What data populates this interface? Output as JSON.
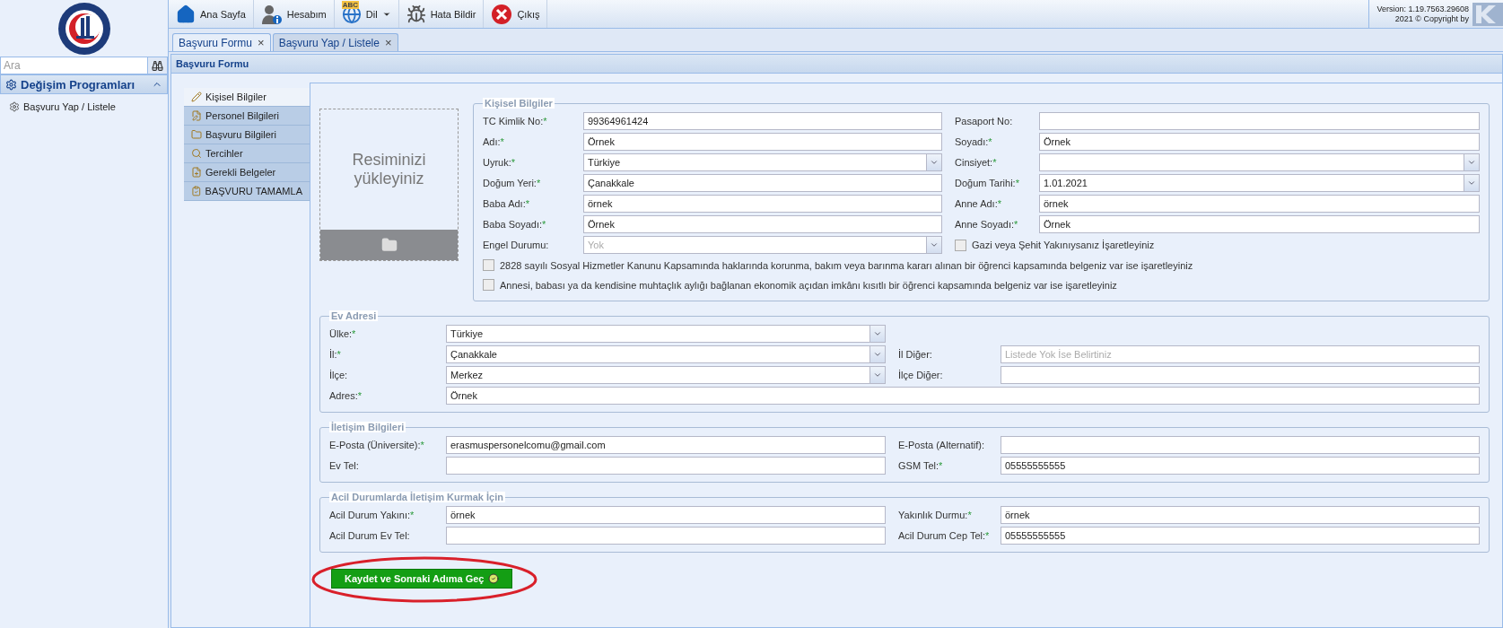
{
  "sidebar": {
    "search": {
      "placeholder": "Ara"
    },
    "section": {
      "title": "Değişim Programları",
      "expanded": true
    },
    "items": [
      {
        "label": "Başvuru Yap / Listele",
        "selected": false
      }
    ]
  },
  "toolbar": {
    "items": [
      {
        "label": "Ana Sayfa",
        "kind": "home"
      },
      {
        "label": "Hesabım",
        "kind": "account"
      },
      {
        "label": "Dil",
        "kind": "language",
        "badge": "ABC",
        "dropdown": true
      },
      {
        "label": "Hata Bildir",
        "kind": "bug"
      },
      {
        "label": "Çıkış",
        "kind": "exit"
      }
    ],
    "version": "Version: 1.19.7563.29608",
    "copyright": "2021 © Copyright by"
  },
  "tabs": [
    {
      "label": "Başvuru Formu",
      "selected": true,
      "close": "×"
    },
    {
      "label": "Başvuru Yap / Listele",
      "selected": false,
      "close": "×"
    }
  ],
  "panel": {
    "title": "Başvuru Formu"
  },
  "steps": [
    {
      "label": "Kişisel Bilgiler",
      "selected": true
    },
    {
      "label": "Personel Bilgileri",
      "selected": false
    },
    {
      "label": "Başvuru Bilgileri",
      "selected": false
    },
    {
      "label": "Tercihler",
      "selected": false
    },
    {
      "label": "Gerekli Belgeler",
      "selected": false
    },
    {
      "label": "BAŞVURU TAMAMLA",
      "selected": false
    }
  ],
  "photo_upload": {
    "text": "Resiminizi yükleyiniz"
  },
  "sections": [
    {
      "title": "Kişisel Bilgiler",
      "rows": [
        {
          "left": {
            "kind": "text",
            "label": "TC Kimlik No:",
            "asterisk": "*",
            "value": "99364961424"
          },
          "right": {
            "kind": "text",
            "label": "Pasaport No:"
          }
        },
        {
          "left": {
            "kind": "text",
            "label": "Adı:",
            "asterisk": "*",
            "value": "Örnek"
          },
          "right": {
            "kind": "text",
            "label": "Soyadı:",
            "asterisk": "*",
            "value": "Örnek"
          }
        },
        {
          "left": {
            "kind": "select",
            "label": "Uyruk:",
            "asterisk": "*",
            "value": "Türkiye"
          },
          "right": {
            "kind": "select",
            "label": "Cinsiyet:",
            "asterisk": "*"
          }
        },
        {
          "left": {
            "kind": "text",
            "label": "Doğum Yeri:",
            "asterisk": "*",
            "value": "Çanakkale"
          },
          "right": {
            "kind": "select",
            "label": "Doğum Tarihi:",
            "asterisk": "*",
            "value": "1.01.2021"
          }
        },
        {
          "left": {
            "kind": "text",
            "label": "Baba Adı:",
            "asterisk": "*",
            "value": "örnek"
          },
          "right": {
            "kind": "text",
            "label": "Anne Adı:",
            "asterisk": "*",
            "value": "örnek"
          }
        },
        {
          "left": {
            "kind": "text",
            "label": "Baba Soyadı:",
            "asterisk": "*",
            "value": "Örnek"
          },
          "right": {
            "kind": "text",
            "label": "Anne Soyadı:",
            "asterisk": "*",
            "value": "Örnek"
          }
        },
        {
          "left": {
            "kind": "select",
            "label": "Engel Durumu:",
            "value": "Yok",
            "disabled": true
          },
          "right": {
            "kind": "checkbox",
            "label": "Gazi veya Şehit Yakınıysanız İşaretleyiniz",
            "checked": false
          }
        },
        {
          "full": {
            "kind": "checkbox",
            "label": "2828 sayılı Sosyal Hizmetler Kanunu Kapsamında haklarında korunma, bakım veya barınma kararı alınan bir öğrenci kapsamında belgeniz var ise işaretleyiniz",
            "checked": false
          }
        },
        {
          "full": {
            "kind": "checkbox",
            "label": "Annesi, babası ya da kendisine muhtaçlık aylığı bağlanan ekonomik açıdan imkânı kısıtlı bir öğrenci kapsamında belgeniz var ise işaretleyiniz",
            "checked": false
          }
        }
      ]
    },
    {
      "title": "Ev Adresi",
      "rows": [
        {
          "left": {
            "kind": "select",
            "label": "Ülke:",
            "asterisk": "*",
            "value": "Türkiye"
          }
        },
        {
          "left": {
            "kind": "select",
            "label": "İl:",
            "asterisk": "*",
            "value": "Çanakkale"
          },
          "right": {
            "kind": "text",
            "label": "İl Diğer:",
            "placeholder": "Listede Yok İse Belirtiniz"
          }
        },
        {
          "left": {
            "kind": "select",
            "label": "İlçe:",
            "value": "Merkez"
          },
          "right": {
            "kind": "text",
            "label": "İlçe Diğer:"
          }
        },
        {
          "wide": {
            "kind": "text",
            "label": "Adres:",
            "asterisk": "*",
            "value": "Örnek"
          }
        }
      ]
    },
    {
      "title": "İletişim Bilgileri",
      "rows": [
        {
          "left": {
            "kind": "text",
            "label": "E-Posta (Üniversite):",
            "asterisk": "*",
            "value": "erasmuspersonelcomu@gmail.com"
          },
          "right": {
            "kind": "text",
            "label": "E-Posta (Alternatif):"
          }
        },
        {
          "left": {
            "kind": "text",
            "label": "Ev Tel:"
          },
          "right": {
            "kind": "text",
            "label": "GSM Tel:",
            "asterisk": "*",
            "value": "05555555555"
          }
        }
      ]
    },
    {
      "title": "Acil Durumlarda İletişim Kurmak İçin",
      "rows": [
        {
          "left": {
            "kind": "text",
            "label": "Acil Durum Yakını:",
            "asterisk": "*",
            "value": "örnek"
          },
          "right": {
            "kind": "text",
            "label": "Yakınlık Durmu:",
            "asterisk": "*",
            "value": "örnek"
          }
        },
        {
          "left": {
            "kind": "text",
            "label": "Acil Durum Ev Tel:"
          },
          "right": {
            "kind": "text",
            "label": "Acil Durum Cep Tel:",
            "asterisk": "*",
            "value": "05555555555"
          }
        }
      ]
    }
  ],
  "save_button": {
    "label": "Kaydet ve Sonraki Adıma Geç",
    "highlighted": true
  }
}
